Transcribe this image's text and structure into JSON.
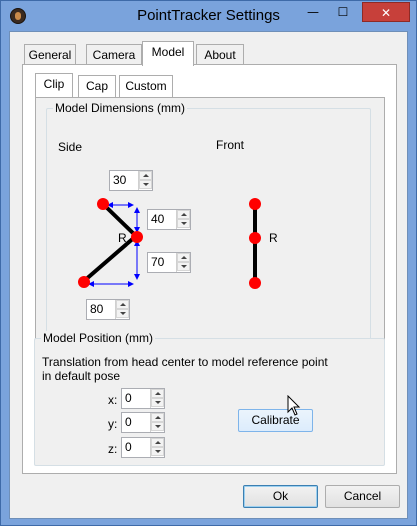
{
  "window": {
    "title": "PointTracker Settings",
    "controls": {
      "minimize": "—",
      "maximize": "☐",
      "close": "✕"
    }
  },
  "tabs": [
    "General",
    "Camera",
    "Model",
    "About"
  ],
  "selected_tab": "Model",
  "sub_tabs": [
    "Clip",
    "Cap",
    "Custom"
  ],
  "selected_sub_tab": "Clip",
  "model_dimensions": {
    "group_title": "Model Dimensions (mm)",
    "side_label": "Side",
    "front_label": "Front",
    "ref_label_side": "R",
    "ref_label_front": "R",
    "spin_top": "30",
    "spin_upper": "40",
    "spin_lower": "70",
    "spin_bottom": "80"
  },
  "model_position": {
    "group_title": "Model Position (mm)",
    "description_line1": "Translation from head center to model reference point",
    "description_line2": "in default pose",
    "x_label": "x:",
    "y_label": "y:",
    "z_label": "z:",
    "x_value": "0",
    "y_value": "0",
    "z_value": "0",
    "calibrate_label": "Calibrate"
  },
  "buttons": {
    "ok": "Ok",
    "cancel": "Cancel"
  },
  "colors": {
    "marker": "#ff0000",
    "arrow": "#0000ff",
    "clip": "#000000"
  }
}
